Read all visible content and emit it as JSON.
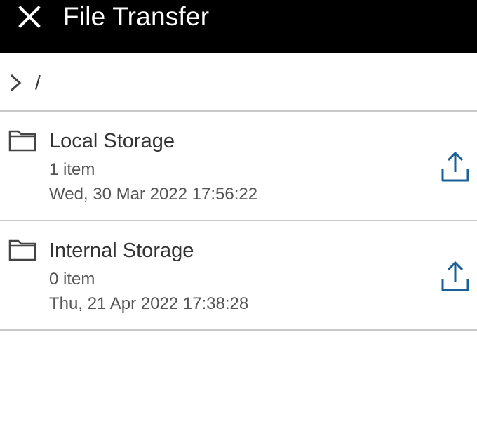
{
  "header": {
    "title": "File Transfer",
    "close_icon": "close-icon"
  },
  "breadcrumb": {
    "chevron_icon": "chevron-right-icon",
    "path": "/"
  },
  "items": [
    {
      "name": "Local Storage",
      "count": "1 item",
      "date": "Wed, 30 Mar 2022 17:56:22",
      "icon": "folder-icon",
      "action_icon": "upload-icon"
    },
    {
      "name": "Internal Storage",
      "count": "0 item",
      "date": "Thu, 21 Apr 2022 17:38:28",
      "icon": "folder-icon",
      "action_icon": "upload-icon"
    }
  ],
  "colors": {
    "header_bg": "#000000",
    "accent": "#1a5f96",
    "divider": "#c8c8c8"
  }
}
